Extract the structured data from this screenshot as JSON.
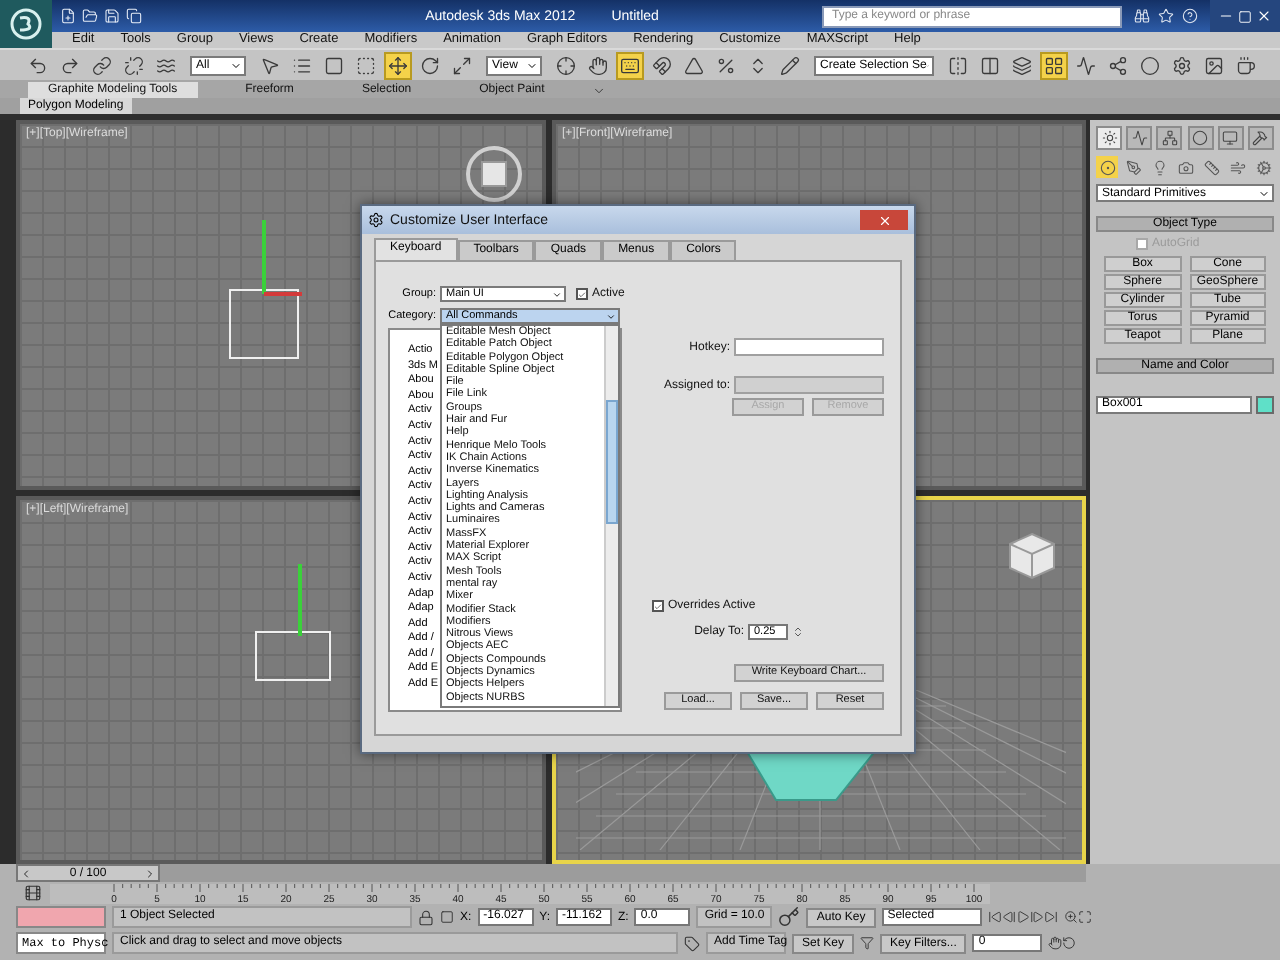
{
  "window": {
    "title": "Autodesk 3ds Max 2012",
    "document": "Untitled"
  },
  "search": {
    "placeholder": "Type a keyword or phrase"
  },
  "menu": [
    "Edit",
    "Tools",
    "Group",
    "Views",
    "Create",
    "Modifiers",
    "Animation",
    "Graph Editors",
    "Rendering",
    "Customize",
    "MAXScript",
    "Help"
  ],
  "toolbar": [
    {
      "kind": "tool",
      "selected": false
    },
    {
      "kind": "tool",
      "selected": false
    },
    {
      "kind": "tool",
      "selected": false
    },
    {
      "kind": "tool",
      "selected": false
    },
    {
      "kind": "tool",
      "selected": false
    },
    {
      "kind": "dropdown",
      "value": "All"
    },
    {
      "kind": "tool",
      "selected": false
    },
    {
      "kind": "tool",
      "selected": false
    },
    {
      "kind": "tool",
      "selected": false
    },
    {
      "kind": "tool",
      "selected": false
    },
    {
      "kind": "tool",
      "selected": true
    },
    {
      "kind": "tool",
      "selected": false
    },
    {
      "kind": "tool",
      "selected": false
    },
    {
      "kind": "dropdown",
      "value": "View"
    },
    {
      "kind": "tool",
      "selected": false
    },
    {
      "kind": "tool",
      "selected": false
    },
    {
      "kind": "tool",
      "selected": true
    },
    {
      "kind": "tool",
      "selected": false
    },
    {
      "kind": "tool",
      "selected": false
    },
    {
      "kind": "tool",
      "selected": false
    },
    {
      "kind": "tool",
      "selected": false
    },
    {
      "kind": "tool",
      "selected": false
    },
    {
      "kind": "dropdown",
      "value": "Create Selection Se"
    },
    {
      "kind": "tool",
      "selected": false
    },
    {
      "kind": "tool",
      "selected": false
    },
    {
      "kind": "tool",
      "selected": false
    },
    {
      "kind": "tool",
      "selected": true
    },
    {
      "kind": "tool",
      "selected": false
    },
    {
      "kind": "tool",
      "selected": false
    },
    {
      "kind": "tool",
      "selected": false
    },
    {
      "kind": "tool",
      "selected": false
    },
    {
      "kind": "tool",
      "selected": false
    },
    {
      "kind": "tool",
      "selected": false
    }
  ],
  "ribbon": {
    "tabs": [
      {
        "label": "Graphite Modeling Tools",
        "selected": true
      },
      {
        "label": "Freeform",
        "selected": false
      },
      {
        "label": "Selection",
        "selected": false
      },
      {
        "label": "Object Paint",
        "selected": false
      }
    ],
    "panel": "Polygon Modeling"
  },
  "viewports": [
    {
      "kind": "top",
      "label": "[+][Top][Wireframe]",
      "active": false
    },
    {
      "kind": "front",
      "label": "[+][Front][Wireframe]",
      "active": false
    },
    {
      "kind": "left",
      "label": "[+][Left][Wireframe]",
      "active": false
    },
    {
      "kind": "perspective",
      "active": true
    }
  ],
  "dialog": {
    "title": "Customize User Interface",
    "tabs": [
      {
        "label": "Keyboard",
        "selected": true
      },
      {
        "label": "Toolbars",
        "selected": false
      },
      {
        "label": "Quads",
        "selected": false
      },
      {
        "label": "Menus",
        "selected": false
      },
      {
        "label": "Colors",
        "selected": false
      }
    ],
    "group": {
      "label": "Group:",
      "value": "Main UI"
    },
    "active": {
      "label": "Active",
      "checked": true
    },
    "category": {
      "label": "Category:",
      "value": "All Commands",
      "expanded": true,
      "options": [
        "Editable Mesh Object",
        "Editable Patch Object",
        "Editable Polygon Object",
        "Editable Spline Object",
        "File",
        "File Link",
        "Groups",
        "Hair and Fur",
        "Help",
        "Henrique Melo Tools",
        "IK Chain Actions",
        "Inverse Kinematics",
        "Layers",
        "Lighting Analysis",
        "Lights and Cameras",
        "Luminaires",
        "MassFX",
        "Material Explorer",
        "MAX Script",
        "Mesh Tools",
        "mental ray",
        "Mixer",
        "Modifier Stack",
        "Modifiers",
        "Nitrous Views",
        "Objects AEC",
        "Objects Compounds",
        "Objects Dynamics",
        "Objects Helpers",
        "Objects NURBS"
      ]
    },
    "actions": [
      "Actio",
      "3ds M",
      "Abou",
      "Abou",
      "Activ",
      "Activ",
      "Activ",
      "Activ",
      "Activ",
      "Activ",
      "Activ",
      "Activ",
      "Activ",
      "Activ",
      "Activ",
      "Activ",
      "Adap",
      "Adap",
      "Add",
      "Add /",
      "Add /",
      "Add E",
      "Add E"
    ],
    "hotkey": {
      "label": "Hotkey:"
    },
    "assigned_to": {
      "label": "Assigned to:"
    },
    "buttons": [
      {
        "label": "Assign",
        "disabled": true
      },
      {
        "label": "Remove",
        "disabled": true
      }
    ],
    "overrides": {
      "label": "Overrides Active",
      "checked": true
    },
    "delay": {
      "label": "Delay To:",
      "value": "0.25"
    },
    "chart_button": "Write Keyboard Chart...",
    "footer_buttons": [
      "Load...",
      "Save...",
      "Reset"
    ]
  },
  "command_panel": {
    "tabs": [
      {
        "selected": true
      },
      {
        "selected": false
      },
      {
        "selected": false
      },
      {
        "selected": false
      },
      {
        "selected": false
      },
      {
        "selected": false
      }
    ],
    "subtabs": [
      {
        "selected": true
      },
      {
        "selected": false
      },
      {
        "selected": false
      },
      {
        "selected": false
      },
      {
        "selected": false
      },
      {
        "selected": false
      },
      {
        "selected": false
      }
    ],
    "category": "Standard Primitives",
    "object_type": {
      "title": "Object Type",
      "autogrid": {
        "label": "AutoGrid",
        "checked": false,
        "disabled": true
      },
      "buttons": [
        "Box",
        "Cone",
        "Sphere",
        "GeoSphere",
        "Cylinder",
        "Tube",
        "Torus",
        "Pyramid",
        "Teapot",
        "Plane"
      ]
    },
    "name_and_color": {
      "title": "Name and Color",
      "name": "Box001"
    }
  },
  "timeline": {
    "position": "0 / 100",
    "ticks": [
      "0",
      "5",
      "10",
      "15",
      "20",
      "25",
      "30",
      "35",
      "40",
      "45",
      "50",
      "55",
      "60",
      "65",
      "70",
      "75",
      "80",
      "85",
      "90",
      "95",
      "100"
    ]
  },
  "status": {
    "listener": "Max to Physc",
    "selection": "1 Object Selected",
    "prompt": "Click and drag to select and move objects",
    "coords": [
      {
        "label": "X:",
        "value": "-16.027"
      },
      {
        "label": "Y:",
        "value": "-11.162"
      },
      {
        "label": "Z:",
        "value": "0.0"
      }
    ],
    "grid": "Grid = 10.0",
    "time_tag": "Add Time Tag"
  },
  "animation": {
    "auto_key": "Auto Key",
    "key_mode": "Selected",
    "set_key": "Set Key",
    "key_filters": "Key Filters...",
    "frame": "0"
  }
}
